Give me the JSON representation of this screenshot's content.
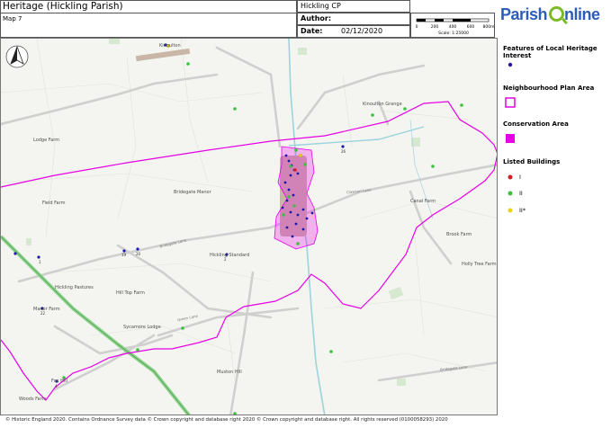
{
  "header": {
    "title": "Heritage (Hickling Parish)",
    "map_number": "Map 7",
    "parish": "Hickling CP",
    "author_label": "Author:",
    "author_value": "",
    "date_label": "Date:",
    "date_value": "02/12/2020",
    "scale_ticks": [
      "0",
      "200",
      "400",
      "600",
      "800m"
    ],
    "scale_text": "Scale: 1:25000",
    "logo_text_left": "Parish",
    "logo_text_right": "nline"
  },
  "legend": {
    "features_title": "Features of Local Heritage Interest",
    "np_area_title": "Neighbourhood Plan Area",
    "conservation_title": "Conservation Area",
    "listed_title": "Listed Buildings",
    "grade_i": "I",
    "grade_ii": "II",
    "grade_ii_star": "II*",
    "colors": {
      "features": "#1a1aa6",
      "np_boundary": "#e600e6",
      "conservation": "#e600e6",
      "grade_i": "#d31f1f",
      "grade_ii": "#3fbf3f",
      "grade_ii_star": "#e8d21b"
    }
  },
  "map": {
    "north_icon": "north-arrow-icon",
    "places": {
      "lodge_farm": "Lodge Farm",
      "bridegate_manor": "Bridegate Manor",
      "field_farm": "Field Farm",
      "hickling_pastures": "Hickling Pastures",
      "hill_top_farm": "Hill Top Farm",
      "manor_farm": "Manor Farm",
      "sycamore_lodge": "Sycamore Lodge",
      "hickling_standard": "Hickling Standard",
      "kinoulton_grange": "Kinoulton Grange",
      "canal_farm": "Canal Farm",
      "brook_farm": "Brook Farm",
      "holly_tree_farm": "Holly Tree Farm",
      "muston_hill": "Muston Hill",
      "woods_farm": "Woods Farm",
      "fox_hill": "Fox Hill",
      "kinoulton": "Kinoulton"
    },
    "roads": {
      "bridegate_lane": "Bridegate Lane",
      "clawson_lane": "Clawson Lane",
      "green_lane": "Green Lane",
      "bridegate_lane_2": "Bridegate Lane"
    },
    "numbers": {
      "n1": "1",
      "n19": "19",
      "n20": "20",
      "n2": "2",
      "n22": "22",
      "n26": "26",
      "n4": "4"
    }
  },
  "footer": {
    "copyright": "© Historic England 2020. Contains Ordnance Survey data © Crown copyright and database right 2020 © Crown copyright and database right. All rights reserved (0100058293) 2020"
  }
}
